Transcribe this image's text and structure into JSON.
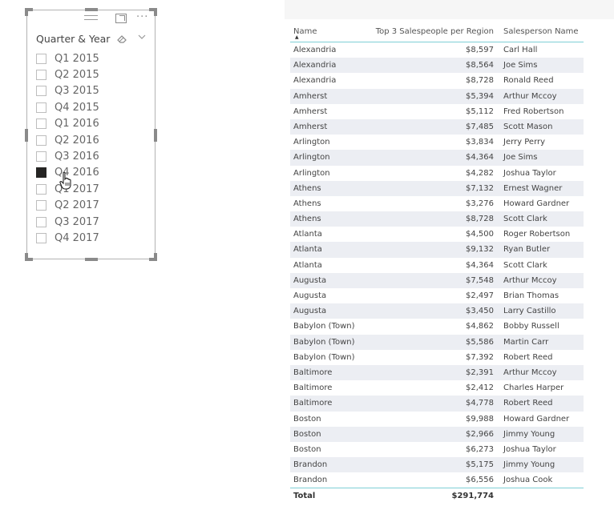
{
  "slicer": {
    "title": "Quarter & Year",
    "icons": {
      "drag": "drag-handle-icon",
      "focus": "focus-mode-icon",
      "more": "more-options-icon",
      "clear": "eraser-icon",
      "dropdown": "chevron-down-icon"
    },
    "more_glyph": "···",
    "clear_glyph": "◇",
    "dropdown_glyph": "⌄",
    "items": [
      {
        "label": "Q1 2015",
        "checked": false
      },
      {
        "label": "Q2 2015",
        "checked": false
      },
      {
        "label": "Q3 2015",
        "checked": false
      },
      {
        "label": "Q4 2015",
        "checked": false
      },
      {
        "label": "Q1 2016",
        "checked": false
      },
      {
        "label": "Q2 2016",
        "checked": false
      },
      {
        "label": "Q3 2016",
        "checked": false
      },
      {
        "label": "Q4 2016",
        "checked": true
      },
      {
        "label": "Q1 2017",
        "checked": false
      },
      {
        "label": "Q2 2017",
        "checked": false
      },
      {
        "label": "Q3 2017",
        "checked": false
      },
      {
        "label": "Q4 2017",
        "checked": false
      }
    ]
  },
  "table": {
    "columns": [
      "Name",
      "Top 3 Salespeople per Region",
      "Salesperson Name"
    ],
    "sort_glyph": "▲",
    "rows": [
      [
        "Alexandria",
        "$8,597",
        "Carl Hall"
      ],
      [
        "Alexandria",
        "$8,564",
        "Joe Sims"
      ],
      [
        "Alexandria",
        "$8,728",
        "Ronald Reed"
      ],
      [
        "Amherst",
        "$5,394",
        "Arthur Mccoy"
      ],
      [
        "Amherst",
        "$5,112",
        "Fred Robertson"
      ],
      [
        "Amherst",
        "$7,485",
        "Scott Mason"
      ],
      [
        "Arlington",
        "$3,834",
        "Jerry Perry"
      ],
      [
        "Arlington",
        "$4,364",
        "Joe Sims"
      ],
      [
        "Arlington",
        "$4,282",
        "Joshua Taylor"
      ],
      [
        "Athens",
        "$7,132",
        "Ernest Wagner"
      ],
      [
        "Athens",
        "$3,276",
        "Howard Gardner"
      ],
      [
        "Athens",
        "$8,728",
        "Scott Clark"
      ],
      [
        "Atlanta",
        "$4,500",
        "Roger Robertson"
      ],
      [
        "Atlanta",
        "$9,132",
        "Ryan Butler"
      ],
      [
        "Atlanta",
        "$4,364",
        "Scott Clark"
      ],
      [
        "Augusta",
        "$7,548",
        "Arthur Mccoy"
      ],
      [
        "Augusta",
        "$2,497",
        "Brian Thomas"
      ],
      [
        "Augusta",
        "$3,450",
        "Larry Castillo"
      ],
      [
        "Babylon (Town)",
        "$4,862",
        "Bobby Russell"
      ],
      [
        "Babylon (Town)",
        "$5,586",
        "Martin Carr"
      ],
      [
        "Babylon (Town)",
        "$7,392",
        "Robert Reed"
      ],
      [
        "Baltimore",
        "$2,391",
        "Arthur Mccoy"
      ],
      [
        "Baltimore",
        "$2,412",
        "Charles Harper"
      ],
      [
        "Baltimore",
        "$4,778",
        "Robert Reed"
      ],
      [
        "Boston",
        "$9,988",
        "Howard Gardner"
      ],
      [
        "Boston",
        "$2,966",
        "Jimmy Young"
      ],
      [
        "Boston",
        "$6,273",
        "Joshua Taylor"
      ],
      [
        "Brandon",
        "$5,175",
        "Jimmy Young"
      ],
      [
        "Brandon",
        "$6,556",
        "Joshua Cook"
      ]
    ],
    "total": {
      "label": "Total",
      "value": "$291,774"
    }
  },
  "colors": {
    "accent_line": "#7ecfd6",
    "stripe": "#eceef3",
    "checked_box": "#252423"
  }
}
